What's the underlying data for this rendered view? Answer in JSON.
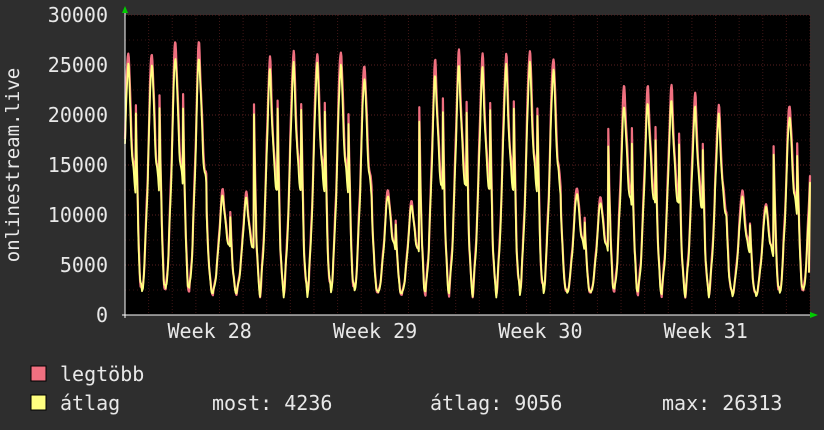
{
  "chart_data": {
    "type": "line",
    "title": "",
    "ylabel": "onlinestream.live",
    "xlabel": "",
    "ylim": [
      0,
      30000
    ],
    "y_ticks": [
      "0",
      "5000",
      "10000",
      "15000",
      "20000",
      "25000",
      "30000"
    ],
    "x_ticks": [
      "Week 28",
      "Week 29",
      "Week 30",
      "Week 31"
    ],
    "grid": true,
    "days": 29,
    "series": [
      {
        "name": "legtöbb",
        "color": "#f07080",
        "daily_peaks": [
          26700,
          26600,
          27600,
          27300,
          12500,
          12200,
          25600,
          26400,
          26400,
          26800,
          25400,
          12600,
          11400,
          25300,
          26200,
          25900,
          26100,
          26700,
          26100,
          12900,
          11900,
          22900,
          22700,
          22700,
          22000,
          21000,
          12600,
          11300,
          21300,
          21400,
          22100
        ],
        "daily_lows": [
          2200,
          2100,
          2200,
          2300,
          2100,
          2200,
          2200,
          2200,
          2100,
          2300,
          2200,
          2100,
          2000,
          2200,
          2300,
          2200,
          2200,
          2300,
          2200,
          2100,
          2100,
          2300,
          2200,
          2200,
          2100,
          2100,
          2000,
          1900,
          2000,
          2200,
          2300
        ]
      },
      {
        "name": "átlag",
        "color": "#ffff80",
        "daily_peaks": [
          25300,
          25400,
          26200,
          26000,
          12000,
          11700,
          24300,
          25000,
          25100,
          25200,
          24000,
          12100,
          11100,
          24000,
          24800,
          24500,
          24800,
          25200,
          24700,
          12300,
          11400,
          21100,
          21200,
          21300,
          20600,
          19900,
          11800,
          10900,
          20100,
          20000,
          21000
        ],
        "daily_lows": [
          2200,
          2100,
          2200,
          2300,
          2100,
          2200,
          2200,
          2200,
          2100,
          2300,
          2200,
          2100,
          2000,
          2200,
          2300,
          2200,
          2200,
          2300,
          2200,
          2100,
          2100,
          2300,
          2200,
          2200,
          2100,
          2100,
          2000,
          1900,
          2000,
          2200,
          2300
        ]
      }
    ],
    "end_value": 4236
  },
  "legend": [
    {
      "label": "legtöbb",
      "color": "#f07080"
    },
    {
      "label": "átlag",
      "color": "#ffff80"
    }
  ],
  "stats": {
    "now": "most: 4236",
    "avg": "átlag: 9056",
    "max": "max: 26313"
  },
  "colors": {
    "background": "#2e2e2e",
    "plot": "#000000",
    "grid": "#5a2020",
    "axis_arrow": "#00cc00",
    "text": "#e8e8e8"
  }
}
